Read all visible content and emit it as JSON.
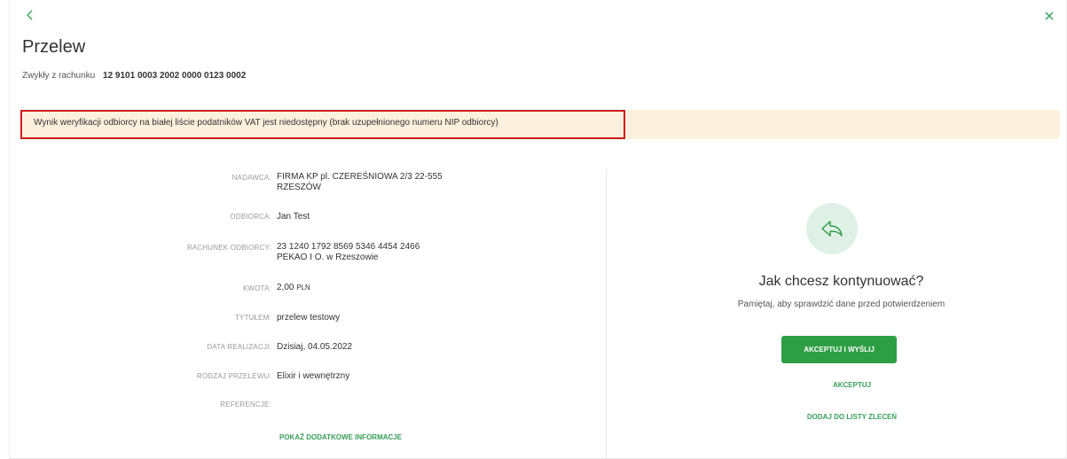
{
  "header": {
    "back_icon": "chevron-left-icon",
    "close_icon": "close-icon",
    "title": "Przelew",
    "account_prefix": "Zwykły z rachunku",
    "account_number": "12 9101 0003 2002 0000 0123 0002"
  },
  "alert": {
    "text": "Wynik weryfikacji odbiorcy na białej liście podatników VAT jest niedostępny (brak uzupełnionego numeru NIP odbiorcy)",
    "background": "#fdf0dc",
    "highlight_color": "#d11a1a"
  },
  "details": {
    "sender_label": "NADAWCA:",
    "sender_line1": "FIRMA KP pl. CZEREŚNIOWA 2/3 22-555",
    "sender_line2": "RZESZÓW",
    "recipient_label": "ODBIORCA:",
    "recipient_value": "Jan Test",
    "recipient_account_label": "RACHUNEK ODBIORCY:",
    "recipient_account_line1": "23 1240 1792 8569 5346 4454 2466",
    "recipient_account_line2": "PEKAO I O. w Rzeszowie",
    "amount_label": "KWOTA:",
    "amount_value": "2,00",
    "amount_currency": "PLN",
    "title_label": "TYTUŁEM:",
    "title_value": "przelew testowy",
    "date_label": "DATA REALIZACJI:",
    "date_value": "Dzisiaj, 04.05.2022",
    "type_label": "RODZAJ PRZELEWU:",
    "type_value": "Elixir i wewnętrzny",
    "references_label": "REFERENCJE:",
    "more_info_link": "POKAŻ DODATKOWE INFORMACJE"
  },
  "actions": {
    "icon": "reply-arrow-icon",
    "question": "Jak chcesz kontynuować?",
    "reminder": "Pamiętaj, aby sprawdzić dane przed potwierdzeniem",
    "accept_send_button": "AKCEPTUJ I WYŚLIJ",
    "accept_link": "AKCEPTUJ",
    "add_to_list_link": "DODAJ DO LISTY ZLECEŃ"
  },
  "colors": {
    "accent": "#3aa05a",
    "button": "#2e9e45"
  }
}
